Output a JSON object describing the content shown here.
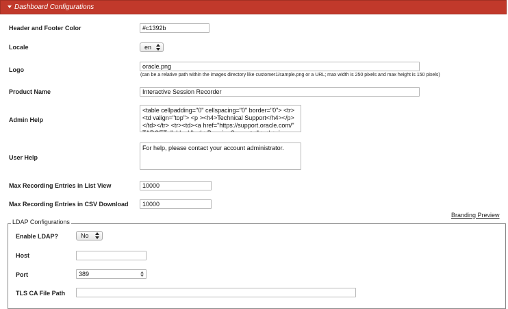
{
  "section": {
    "title": "Dashboard Configurations"
  },
  "fields": {
    "header_footer_color": {
      "label": "Header and Footer Color",
      "value": "#c1392b"
    },
    "locale": {
      "label": "Locale",
      "value": "en"
    },
    "logo": {
      "label": "Logo",
      "value": "oracle.png",
      "hint": "(can be a relative path within the images directory like customer1/sample.png or a URL; max width is 250 pixels and max height is 150 pixels)"
    },
    "product_name": {
      "label": "Product Name",
      "value": "Interactive Session Recorder"
    },
    "admin_help": {
      "label": "Admin Help",
      "value": "<table cellpadding=\"0\" cellspacing=\"0\" border=\"0\"> <tr> <td valign=\"top\"> <p ><h4>Technical Support</h4></p> </td></tr> <tr><td><a href=\"https://support.oracle.com/\" TARGET=\"_blank\"><b>Premier Support</b></a> is"
    },
    "user_help": {
      "label": "User Help",
      "value": "For help, please contact your account administrator."
    },
    "max_list_view": {
      "label": "Max Recording Entries in List View",
      "value": "10000"
    },
    "max_csv_download": {
      "label": "Max Recording Entries in CSV Download",
      "value": "10000"
    }
  },
  "branding_preview": {
    "label": "Branding Preview"
  },
  "ldap": {
    "legend": "LDAP Configurations",
    "enable": {
      "label": "Enable LDAP?",
      "value": "No"
    },
    "host": {
      "label": "Host",
      "value": ""
    },
    "port": {
      "label": "Port",
      "value": "389"
    },
    "tls_ca_file_path": {
      "label": "TLS CA File Path",
      "value": ""
    }
  },
  "colors": {
    "header_bar": "#c1392b"
  },
  "icons": {
    "section_toggle": "caret-down-icon",
    "select": "updown-arrows-icon"
  }
}
